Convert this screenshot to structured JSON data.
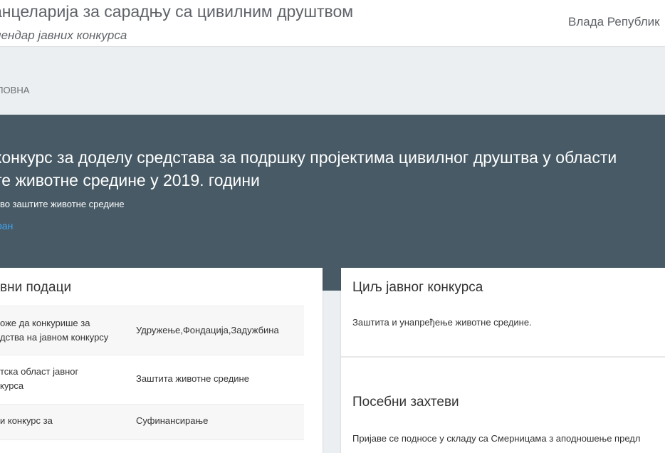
{
  "header": {
    "site_title": "анцеларија за сарадњу са цивилним друштвом",
    "site_subtitle": "лендар јавних конкурса",
    "gov_link": "Влада Републик"
  },
  "breadcrumb": {
    "home": "ЛОВНА"
  },
  "hero": {
    "title_line1": "конкурс за доделу средстава за подршку пројектима цивилног друштва у области",
    "title_line2": "те животне средине у 2019. години",
    "organization": "тво заштите животне средине",
    "status": "ран"
  },
  "basic_data": {
    "heading": "вни подаци",
    "rows": [
      {
        "label_line1": "оже да конкурише за",
        "label_line2": "дства на јавном конкурсу",
        "value": "Удружење,Фондација,Задужбина"
      },
      {
        "label_line1": "тска област јавног",
        "label_line2": "курса",
        "value": "Заштита животне средине"
      },
      {
        "label_line1": "и конкурс за",
        "label_line2": "",
        "value": "Суфинансирање"
      }
    ]
  },
  "goal": {
    "heading": "Циљ јавног конкурса",
    "text": "Заштита и унапређење животне средине."
  },
  "requirements": {
    "heading": "Посебни захтеви",
    "text": "Пријаве се подносе у складу са Смерницама з аподношење предл"
  }
}
